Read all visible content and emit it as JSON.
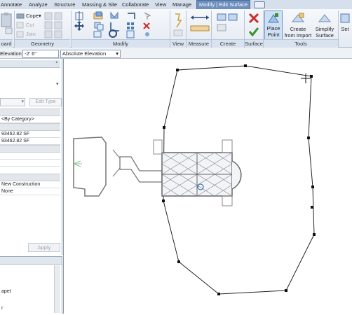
{
  "ribbon_tabs": [
    "Annotate",
    "Analyze",
    "Structure",
    "Massing & Site",
    "Collaborate",
    "View",
    "Manage",
    "Modify | Edit Surface"
  ],
  "clipboard_panel_label": "oard",
  "geometry": {
    "cope": "Cope",
    "cut": "Cut",
    "join": "Join",
    "label": "Geometry"
  },
  "panels": {
    "modify": "Modify",
    "view": "View",
    "measure": "Measure",
    "create": "Create",
    "surface": "Surface",
    "tools": "Tools"
  },
  "tools": {
    "place_point": [
      "Place",
      "Point"
    ],
    "create_from_import": [
      "Create",
      "from Import"
    ],
    "simplify_surface": [
      "Simplify",
      "Surface"
    ],
    "set": "Set"
  },
  "options_bar": {
    "elevation_label": "Elevation",
    "elevation_value": "-2'  6\"",
    "mode": "Absolute Elevation"
  },
  "properties": {
    "type_selector_button": "Edit Type",
    "by_category": "<By Category>",
    "area_1": "93462.82 SF",
    "area_2": "93462.82 SF",
    "phase_created": "New Construction",
    "phase_demolished": "None",
    "apply": "Apply"
  },
  "browser": {
    "item_1": "apet",
    "item_2": "r"
  },
  "colors": {
    "accent": "#4d7ab5",
    "ribbon_active": "#6d8fbd",
    "cancel_red": "#cc2a2a",
    "finish_green": "#3d8f2d"
  },
  "icons": [
    "paste-icon",
    "cope-icon",
    "cut-icon",
    "join-icon",
    "align-icon",
    "offset-icon",
    "mirror-icon",
    "move-icon",
    "copy-icon",
    "rotate-icon",
    "trim-icon",
    "split-icon",
    "array-icon",
    "scale-icon",
    "pin-icon",
    "delete-icon",
    "hide-icon",
    "measure-icon",
    "create-icon",
    "cancel-icon",
    "finish-icon",
    "place-point-icon",
    "create-from-import-icon",
    "simplify-surface-icon",
    "set-icon",
    "crosshair-cursor-icon"
  ]
}
